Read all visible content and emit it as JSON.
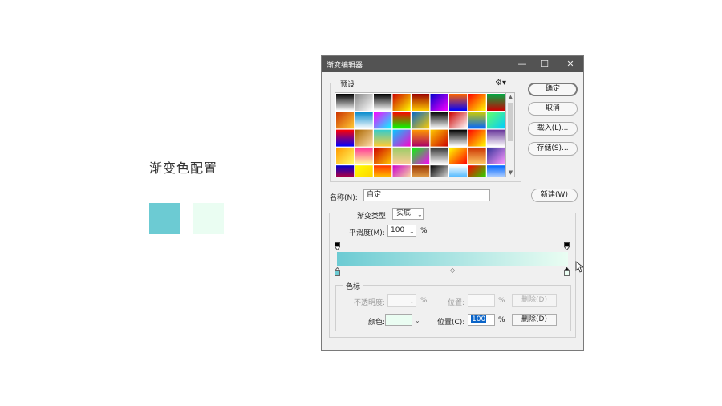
{
  "slide": {
    "title": "渐变色配置",
    "swatch_colors": [
      "#6ccbd3",
      "#eafdf2"
    ]
  },
  "dialog": {
    "title": "渐变编辑器",
    "window_controls": [
      "—",
      "☐",
      "✕"
    ],
    "presets_label": "预设",
    "buttons": {
      "ok": "确定",
      "cancel": "取消",
      "load": "载入(L)...",
      "save": "存储(S)...",
      "new": "新建(W)"
    },
    "name_label": "名称(N):",
    "name_value": "自定",
    "gradient_type_label": "渐变类型:",
    "gradient_type_value": "实底",
    "smoothness_label": "平滑度(M):",
    "smoothness_value": "100",
    "percent": "%",
    "gradient": {
      "start_color": "#6ccbd3",
      "end_color": "#eafdf2"
    },
    "stops_group_label": "色标",
    "opacity_label": "不透明度:",
    "opacity_value": "",
    "location_label_disabled": "位置:",
    "delete_label_disabled": "删除(D)",
    "color_label": "颜色:",
    "color_value": "#eafdf2",
    "location_label": "位置(C):",
    "location_value": "100",
    "delete_label": "删除(D)"
  }
}
